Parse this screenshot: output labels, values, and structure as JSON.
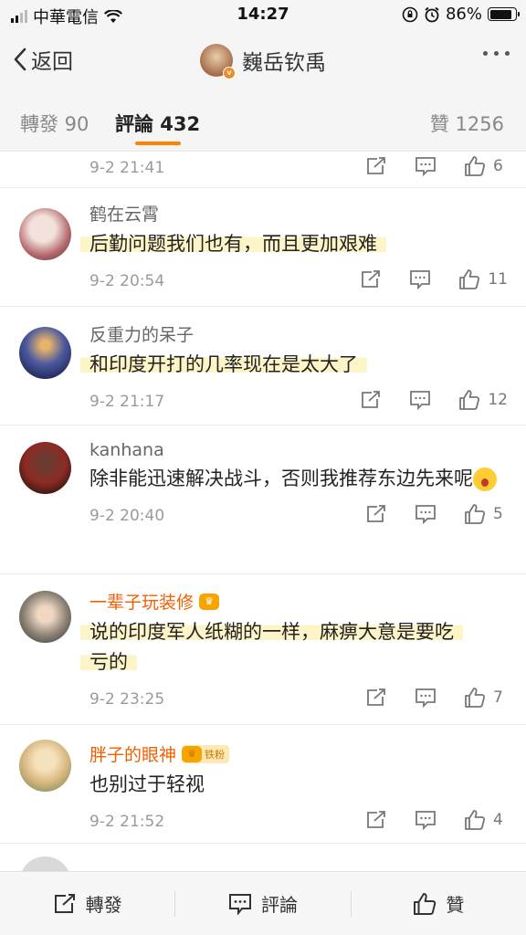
{
  "status_bar": {
    "carrier": "中華電信",
    "time": "14:27",
    "battery": "86%",
    "battery_level": 0.86
  },
  "nav": {
    "back_label": "返回",
    "title": "巍岳钦禹"
  },
  "tabs": {
    "repost": "轉發 90",
    "comments": "評論 432",
    "likes": "贊 1256"
  },
  "comments": [
    {
      "time": "9-2 21:41",
      "likes": "6"
    },
    {
      "name": "鹤在云霄",
      "text": "后勤问题我们也有，而且更加艰难",
      "time": "9-2 20:54",
      "likes": "11"
    },
    {
      "name": "反重力的呆子",
      "text": "和印度开打的几率现在是太大了",
      "time": "9-2 21:17",
      "likes": "12"
    },
    {
      "name": "kanhana",
      "text": "除非能迅速解决战斗，否则我推荐东边先来呢",
      "time": "9-2 20:40",
      "likes": "5"
    },
    {
      "name": "一辈子玩装修",
      "text_line1": "说的印度军人纸糊的一样，麻痹大意是要吃",
      "text_line2": "亏的",
      "time": "9-2 23:25",
      "likes": "7"
    },
    {
      "name": "胖子的眼神",
      "badge": "铁粉",
      "text": "也别过于轻视",
      "time": "9-2 21:52",
      "likes": "4"
    }
  ],
  "bottom_bar": {
    "repost": "轉發",
    "comment": "評論",
    "like": "贊"
  },
  "colors": {
    "accent": "#ff8200",
    "vip_name": "#f06000",
    "highlight": "#fdf5c7"
  }
}
